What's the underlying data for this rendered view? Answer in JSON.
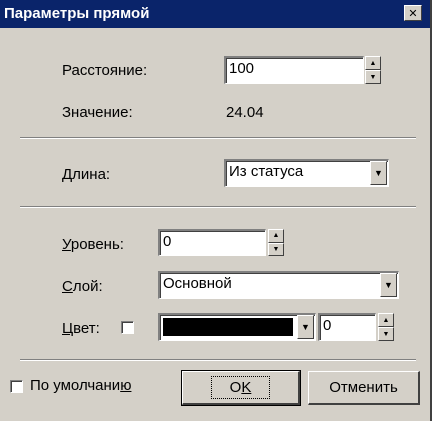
{
  "window": {
    "title": "Параметры прямой",
    "close_glyph": "✕"
  },
  "distance": {
    "label": "Расстояние:",
    "value": "100"
  },
  "value_row": {
    "label": "Значение:",
    "value": "24.04"
  },
  "length": {
    "label": "Длина:",
    "selected": "Из статуса"
  },
  "level": {
    "label_hot": "У",
    "label_rest": "ровень:",
    "value": "0"
  },
  "layer": {
    "label_hot": "С",
    "label_rest": "лой:",
    "selected": "Основной"
  },
  "color": {
    "label_hot": "Ц",
    "label_rest": "вет:",
    "swatch": "#000000",
    "width_value": "0"
  },
  "footer": {
    "default_label_pre": "По умолчани",
    "default_label_hot": "ю",
    "ok_pre": "O",
    "ok_hot": "K",
    "cancel_label": "Отменить"
  },
  "icons": {
    "spin_up": "▲",
    "spin_down": "▼",
    "dropdown": "▼"
  },
  "colors": {
    "title_bg": "#0a246a",
    "face": "#d4d0c8"
  }
}
